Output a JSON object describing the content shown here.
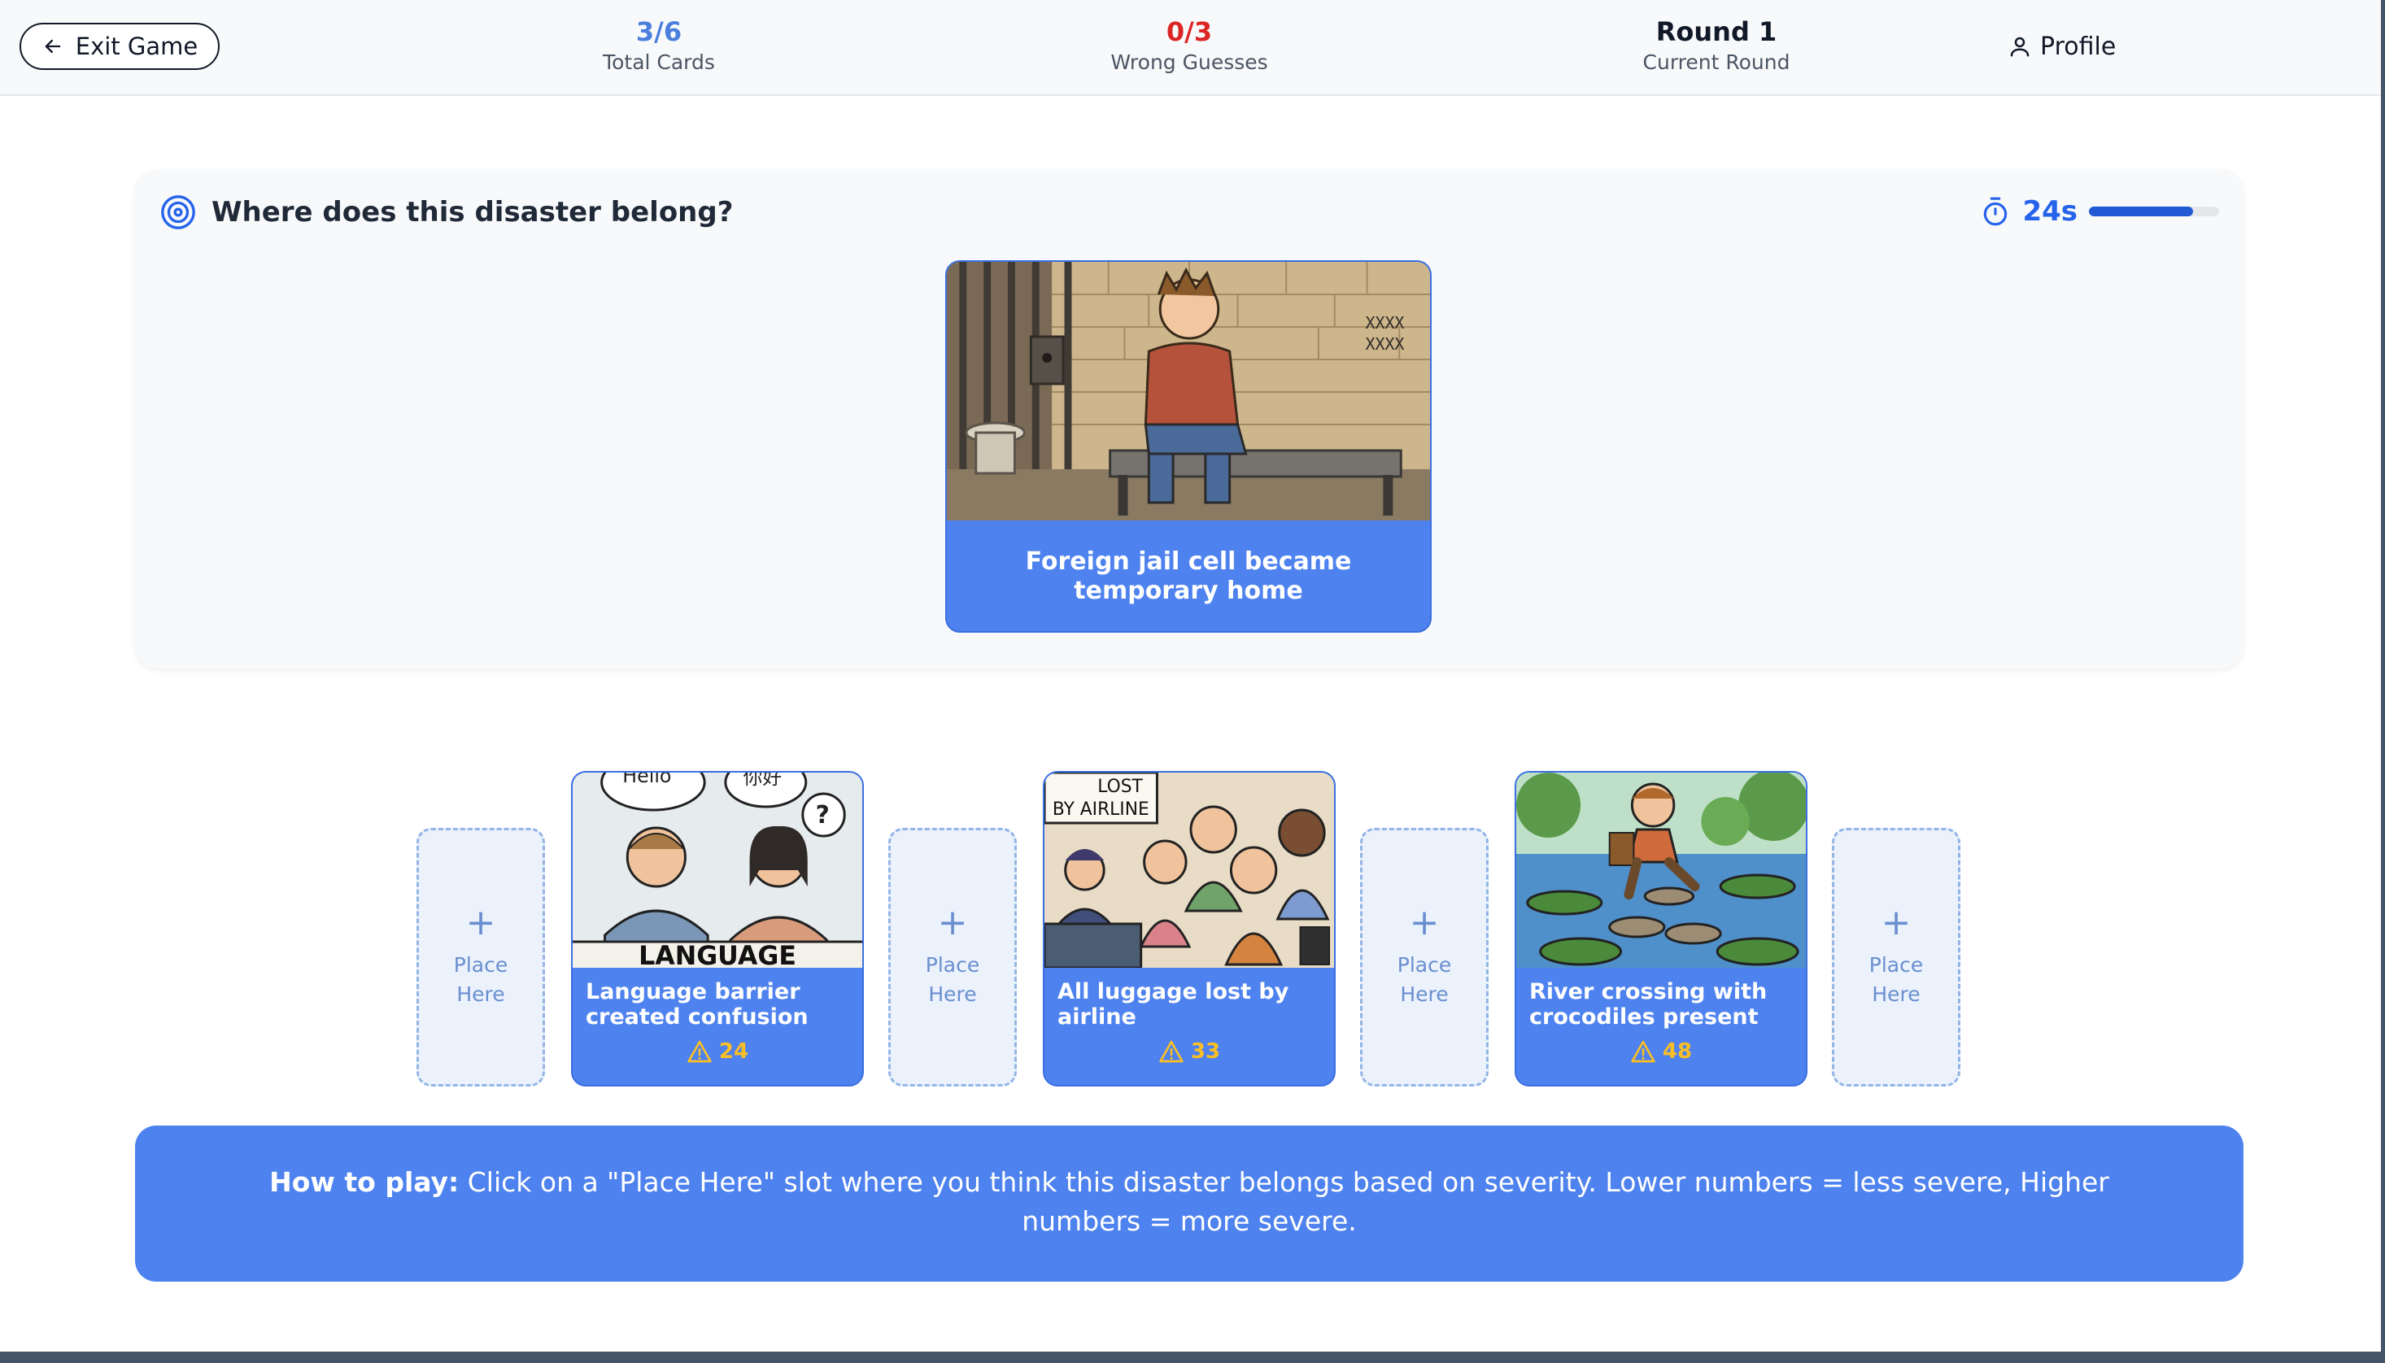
{
  "header": {
    "exit_label": "Exit Game",
    "stats": [
      {
        "value": "3/6",
        "label": "Total Cards",
        "color": "#4a7fdc"
      },
      {
        "value": "0/3",
        "label": "Wrong Guesses",
        "color": "#dc2626"
      },
      {
        "value": "Round 1",
        "label": "Current Round",
        "color": "#111827"
      }
    ],
    "profile_label": "Profile"
  },
  "question": {
    "title": "Where does this disaster belong?",
    "timer_text": "24s",
    "timer_fraction": 0.8,
    "card_caption": "Foreign jail cell became temporary home"
  },
  "timeline": {
    "slot_label": "Place Here",
    "cards": [
      {
        "caption": "Language barrier created confusion",
        "score": "24",
        "art_text": [
          "Hello",
          "你好",
          "?",
          "LANGUAGE"
        ]
      },
      {
        "caption": "All luggage lost by airline",
        "score": "33",
        "art_text": [
          "LOST",
          "BY AIRLINE"
        ]
      },
      {
        "caption": "River crossing with crocodiles present",
        "score": "48",
        "art_text": []
      }
    ]
  },
  "main_card_art_text": [
    "XXXX",
    "XXXX"
  ],
  "howto": {
    "lead": "How to play:",
    "text": "Click on a \"Place Here\" slot where you think this disaster belongs based on severity. Lower numbers = less severe, Higher numbers = more severe."
  },
  "colors": {
    "accent": "#4e82ee",
    "score": "#fbbf24",
    "wrong": "#dc2626"
  }
}
